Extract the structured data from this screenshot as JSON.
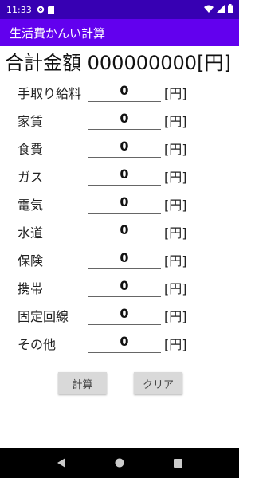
{
  "status_bar": {
    "time": "11:33",
    "icons": [
      "gear-icon",
      "sd-card-icon",
      "wifi-icon",
      "signal-icon",
      "battery-icon"
    ]
  },
  "app_bar": {
    "title": "生活費かんい計算"
  },
  "total": {
    "label": "合計金額",
    "value": "000000000",
    "unit": "[円]"
  },
  "rows": [
    {
      "label": "手取り給料",
      "value": "0",
      "unit": "[円]"
    },
    {
      "label": "家賃",
      "value": "0",
      "unit": "[円]"
    },
    {
      "label": "食費",
      "value": "0",
      "unit": "[円]"
    },
    {
      "label": "ガス",
      "value": "0",
      "unit": "[円]"
    },
    {
      "label": "電気",
      "value": "0",
      "unit": "[円]"
    },
    {
      "label": "水道",
      "value": "0",
      "unit": "[円]"
    },
    {
      "label": "保険",
      "value": "0",
      "unit": "[円]"
    },
    {
      "label": "携帯",
      "value": "0",
      "unit": "[円]"
    },
    {
      "label": "固定回線",
      "value": "0",
      "unit": "[円]"
    },
    {
      "label": "その他",
      "value": "0",
      "unit": "[円]"
    }
  ],
  "buttons": {
    "calc": "計算",
    "clear": "クリア"
  },
  "colors": {
    "primary": "#6200ee",
    "primary_dark": "#3700b3",
    "button": "#d9d9d9"
  },
  "nav": {
    "icons": [
      "back-icon",
      "home-icon",
      "recents-icon"
    ]
  }
}
